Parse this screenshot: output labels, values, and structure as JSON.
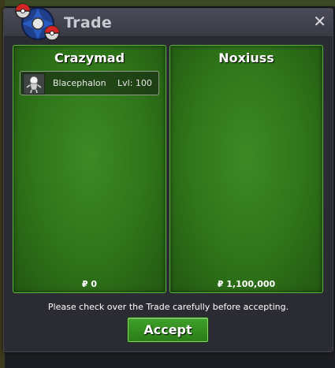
{
  "window": {
    "title": "Trade",
    "close_glyph": "✕"
  },
  "left_panel": {
    "player_name": "Crazymad",
    "items": [
      {
        "icon": "blacephalon-sprite-icon",
        "name": "Blacephalon",
        "level": "Lvl: 100"
      }
    ],
    "money": "₽ 0"
  },
  "right_panel": {
    "player_name": "Noxiuss",
    "items": [],
    "money": "₽ 1,100,000"
  },
  "notice": "Please check over the Trade carefully before accepting.",
  "accept_label": "Accept",
  "colors": {
    "panel_green": "#2f7419",
    "panel_border": "#5bb23c",
    "window_bg": "#2b2c33",
    "title_text": "#c9c9d2"
  }
}
